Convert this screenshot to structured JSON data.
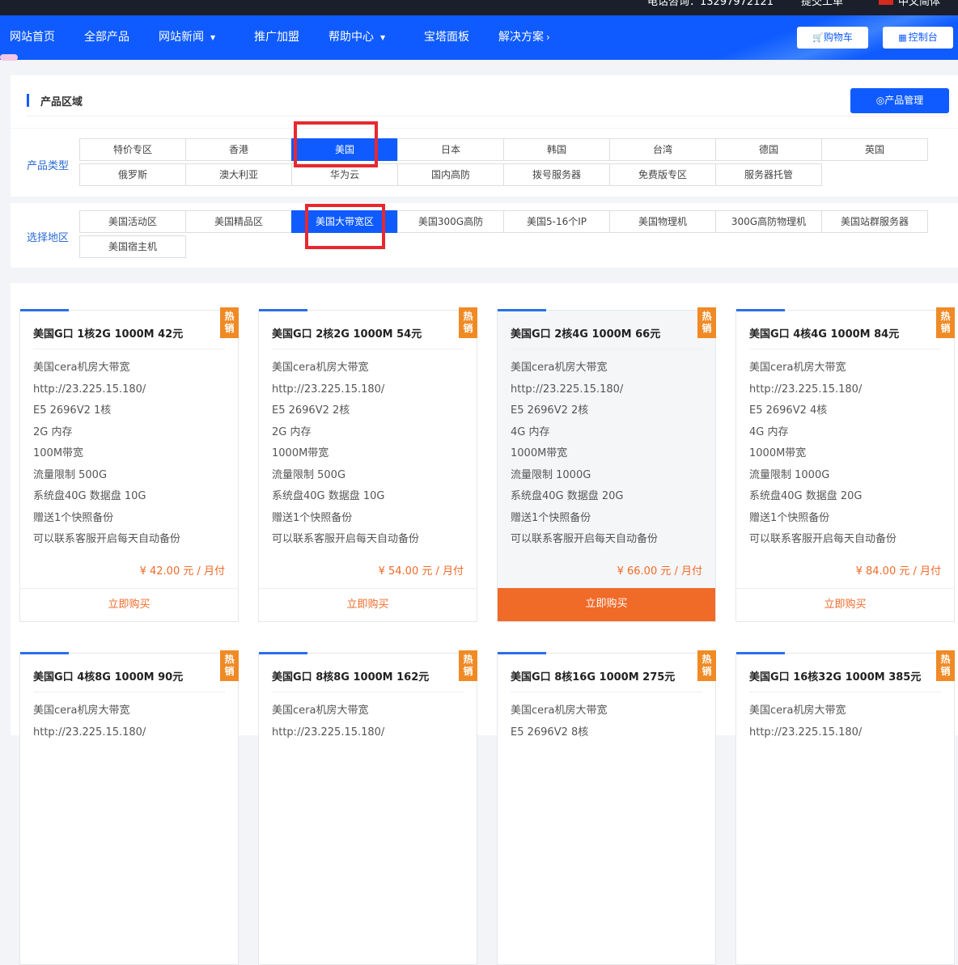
{
  "topbar": {
    "phone": "电话咨询：13297972121",
    "ticket": "提交工单",
    "lang": "中文简体",
    "colors": {
      "flag": "#d52b1e"
    }
  },
  "nav": {
    "items": [
      "网站首页",
      "全部产品",
      "网站新闻",
      "推广加盟",
      "帮助中心",
      "宝塔面板",
      "解决方案"
    ],
    "cart": "购物车",
    "console": "控制台",
    "colors": {
      "bg": "#0f5bff"
    }
  },
  "panel": {
    "title": "产品区域",
    "manage": "产品管理"
  },
  "filters": {
    "type_label": "产品类型",
    "types": [
      "特价专区",
      "香港",
      "美国",
      "日本",
      "韩国",
      "台湾",
      "德国",
      "英国",
      "俄罗斯",
      "澳大利亚",
      "华为云",
      "国内高防",
      "拨号服务器",
      "免费版专区",
      "服务器托管"
    ],
    "type_selected": "美国",
    "region_label": "选择地区",
    "regions": [
      "美国活动区",
      "美国精品区",
      "美国大带宽区",
      "美国300G高防",
      "美国5-16个IP",
      "美国物理机",
      "300G高防物理机",
      "美国站群服务器",
      "美国宿主机"
    ],
    "region_selected": "美国大带宽区"
  },
  "products": [
    {
      "title": "美国G口 1核2G 1000M 42元",
      "hot": "热销",
      "features": [
        "美国cera机房大带宽",
        "http://23.225.15.180/",
        "E5 2696V2 1核",
        "2G 内存",
        "100M带宽",
        "流量限制 500G",
        "系统盘40G 数据盘 10G",
        "赠送1个快照备份",
        "可以联系客服开启每天自动备份"
      ],
      "price": "¥ 42.00 元 / 月付",
      "buy": "立即购买"
    },
    {
      "title": "美国G口 2核2G 1000M 54元",
      "hot": "热销",
      "features": [
        "美国cera机房大带宽",
        "http://23.225.15.180/",
        "E5 2696V2 2核",
        "2G 内存",
        "1000M带宽",
        "流量限制 500G",
        "系统盘40G 数据盘 10G",
        "赠送1个快照备份",
        "可以联系客服开启每天自动备份"
      ],
      "price": "¥ 54.00 元 / 月付",
      "buy": "立即购买"
    },
    {
      "title": "美国G口 2核4G 1000M 66元",
      "hot": "热销",
      "features": [
        "美国cera机房大带宽",
        "http://23.225.15.180/",
        "E5 2696V2 2核",
        "4G 内存",
        "1000M带宽",
        "流量限制 1000G",
        "系统盘40G 数据盘 20G",
        "赠送1个快照备份",
        "可以联系客服开启每天自动备份"
      ],
      "price": "¥ 66.00 元 / 月付",
      "buy": "立即购买"
    },
    {
      "title": "美国G口 4核4G 1000M 84元",
      "hot": "热销",
      "features": [
        "美国cera机房大带宽",
        "http://23.225.15.180/",
        "E5 2696V2 4核",
        "4G 内存",
        "1000M带宽",
        "流量限制 1000G",
        "系统盘40G 数据盘 20G",
        "赠送1个快照备份",
        "可以联系客服开启每天自动备份"
      ],
      "price": "¥ 84.00 元 / 月付",
      "buy": "立即购买"
    },
    {
      "title": "美国G口 4核8G 1000M 90元",
      "hot": "热销",
      "features": [
        "美国cera机房大带宽",
        "http://23.225.15.180/"
      ],
      "price": "",
      "buy": ""
    },
    {
      "title": "美国G口 8核8G 1000M 162元",
      "hot": "热销",
      "features": [
        "美国cera机房大带宽",
        "http://23.225.15.180/"
      ],
      "price": "",
      "buy": ""
    },
    {
      "title": "美国G口 8核16G 1000M 275元",
      "hot": "热销",
      "features": [
        "美国cera机房大带宽",
        "E5 2696V2 8核"
      ],
      "price": "",
      "buy": ""
    },
    {
      "title": "美国G口 16核32G 1000M 385元",
      "hot": "热销",
      "features": [
        "美国cera机房大带宽",
        "http://23.225.15.180/"
      ],
      "price": "",
      "buy": ""
    }
  ],
  "theme": {
    "accent": "#0f5bff",
    "orange": "#f06a28",
    "hot_badge": "#f08a25",
    "highlight_box": "#e8282f"
  }
}
